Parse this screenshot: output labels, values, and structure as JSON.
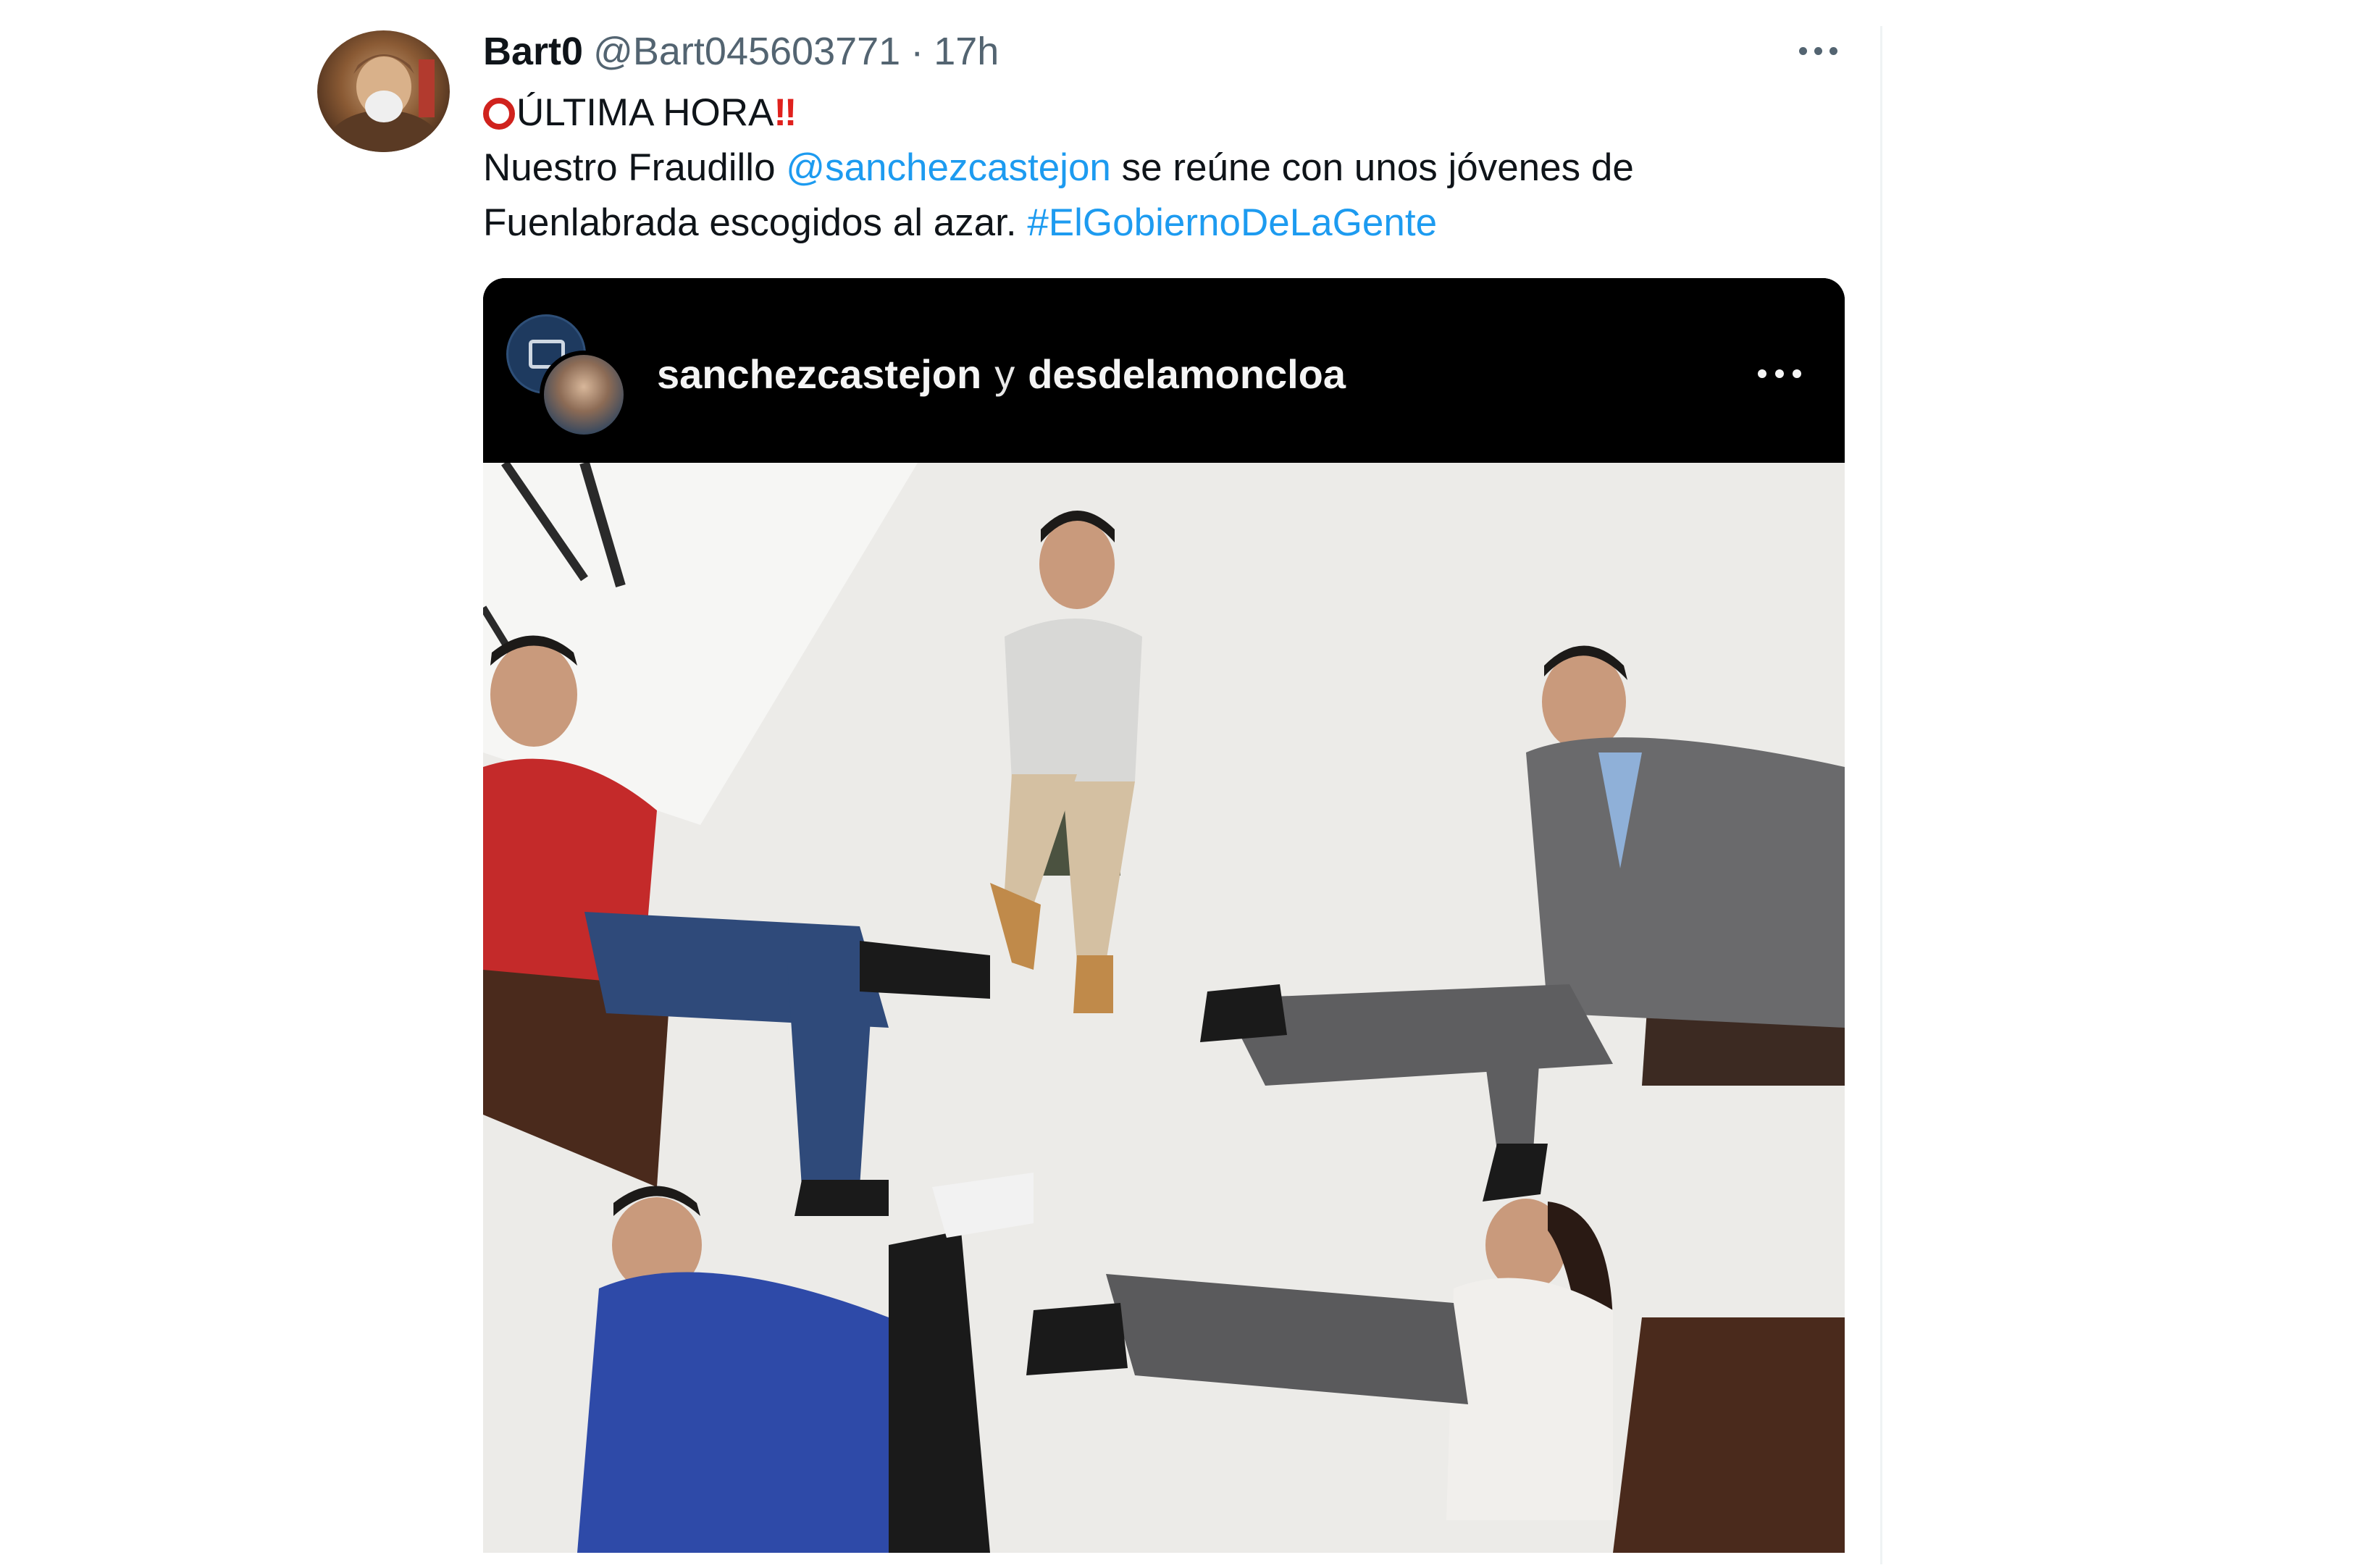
{
  "tweet": {
    "author": {
      "display_name": "Bart0",
      "handle": "@Bart045603771",
      "separator": "·",
      "timestamp": "17h"
    },
    "text": {
      "headline": "ÚLTIMA HORA",
      "headline_suffix": "‼",
      "line2_pre": "Nuestro Fraudillo ",
      "mention": "@sanchezcastejon",
      "line2_post": " se reúne con unos jóvenes de",
      "line3_pre": "Fuenlabrada escogidos al azar. ",
      "hashtag": "#ElGobiernoDeLaGente"
    },
    "icons": {
      "headline_prefix": "red-circle-icon",
      "headline_suffix": "double-exclamation-icon",
      "more": "more-horizontal-icon"
    }
  },
  "embedded_post": {
    "users": [
      "sanchezcastejon",
      "desdelamoncloa"
    ],
    "joiner": "y",
    "more_icon": "more-horizontal-icon"
  },
  "colors": {
    "link": "#1d9bf0",
    "text": "#0f1419",
    "secondary": "#536471",
    "alert_red": "#d0221d"
  }
}
